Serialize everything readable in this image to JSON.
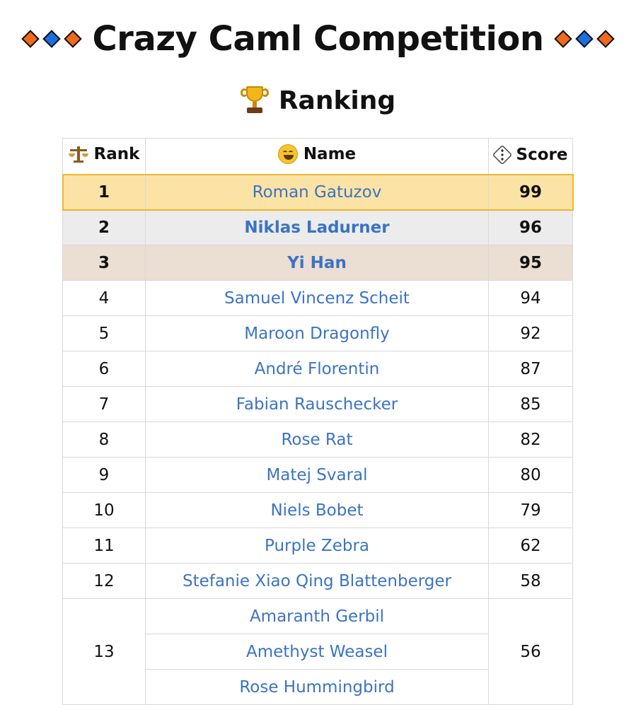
{
  "title": "Crazy Caml Competition",
  "subtitle": "Ranking",
  "icons": {
    "title_left": [
      "orange-diamond-icon",
      "blue-diamond-icon",
      "orange-diamond-icon"
    ],
    "title_right": [
      "orange-diamond-icon",
      "blue-diamond-icon",
      "orange-diamond-icon"
    ],
    "subtitle": "trophy-icon",
    "rank_header": "balance-scale-icon",
    "name_header": "smiling-face-icon",
    "score_header": "game-die-icon"
  },
  "colors": {
    "gold_row": "#fbe3a5",
    "gold_border": "#f0b52c",
    "silver_row": "#ececec",
    "bronze_row": "#ebded2",
    "link": "#3b73c4",
    "diamond_orange": "#f06a1c",
    "diamond_blue": "#1b6fe0"
  },
  "table": {
    "headers": {
      "rank": "Rank",
      "name": "Name",
      "score": "Score"
    },
    "rows": [
      {
        "rank": "1",
        "names": [
          "Roman Gatuzov"
        ],
        "score": "99"
      },
      {
        "rank": "2",
        "names": [
          "Niklas Ladurner"
        ],
        "score": "96"
      },
      {
        "rank": "3",
        "names": [
          "Yi Han"
        ],
        "score": "95"
      },
      {
        "rank": "4",
        "names": [
          "Samuel Vincenz Scheit"
        ],
        "score": "94"
      },
      {
        "rank": "5",
        "names": [
          "Maroon Dragonfly"
        ],
        "score": "92"
      },
      {
        "rank": "6",
        "names": [
          "André Florentin"
        ],
        "score": "87"
      },
      {
        "rank": "7",
        "names": [
          "Fabian Rauschecker"
        ],
        "score": "85"
      },
      {
        "rank": "8",
        "names": [
          "Rose Rat"
        ],
        "score": "82"
      },
      {
        "rank": "9",
        "names": [
          "Matej Svaral"
        ],
        "score": "80"
      },
      {
        "rank": "10",
        "names": [
          "Niels Bobet"
        ],
        "score": "79"
      },
      {
        "rank": "11",
        "names": [
          "Purple Zebra"
        ],
        "score": "62"
      },
      {
        "rank": "12",
        "names": [
          "Stefanie Xiao Qing Blattenberger"
        ],
        "score": "58"
      },
      {
        "rank": "13",
        "names": [
          "Amaranth Gerbil",
          "Amethyst Weasel",
          "Rose Hummingbird"
        ],
        "score": "56"
      }
    ]
  }
}
